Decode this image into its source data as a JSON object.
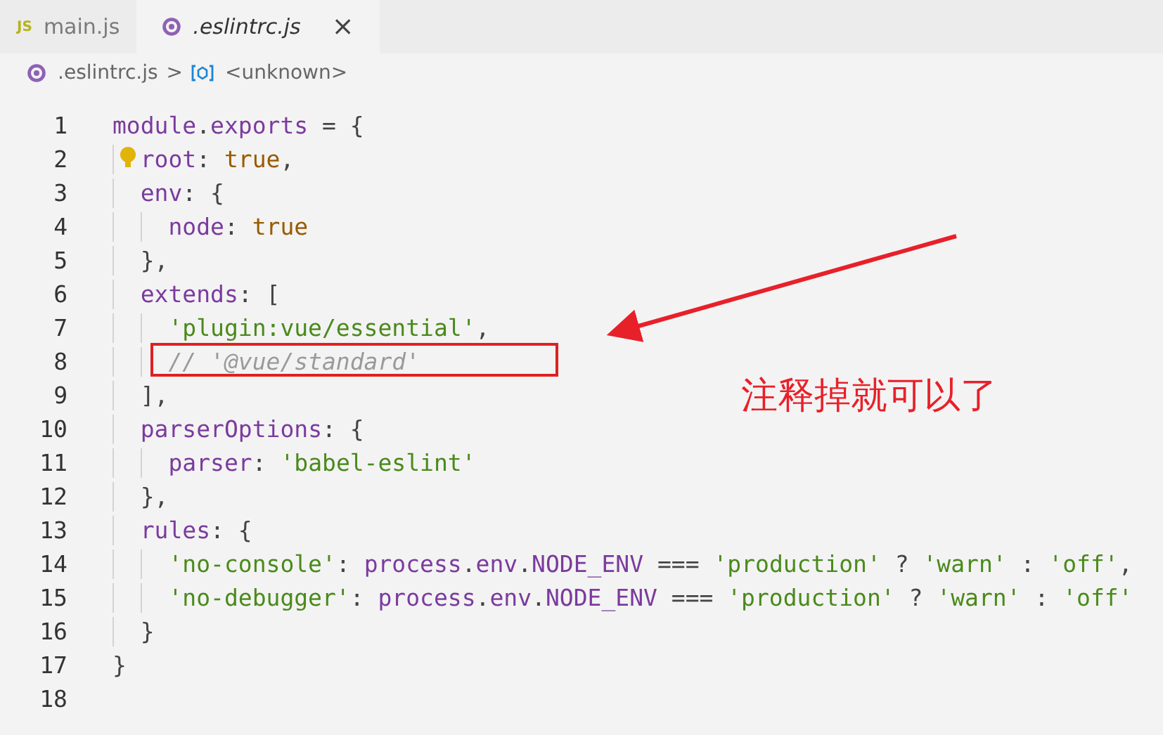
{
  "tabs": [
    {
      "kind": "js",
      "icon_text": "JS",
      "label": "main.js",
      "selected": false
    },
    {
      "kind": "config",
      "label": ".eslintrc.js",
      "selected": true
    }
  ],
  "close_glyph": "×",
  "breadcrumb": {
    "file": ".eslintrc.js",
    "separator": ">",
    "symbol": "<unknown>"
  },
  "lines": [
    {
      "number": "1",
      "boxed": false,
      "tokens": [
        {
          "kind": "ident",
          "text": "module"
        },
        {
          "kind": "punct",
          "text": "."
        },
        {
          "kind": "ident",
          "text": "exports"
        },
        {
          "kind": "punct",
          "text": " = {"
        }
      ]
    },
    {
      "number": "2",
      "boxed": false,
      "bulb": true,
      "tokens": [
        {
          "kind": "ident",
          "text": "root"
        },
        {
          "kind": "punct",
          "text": ": "
        },
        {
          "kind": "kw",
          "text": "true"
        },
        {
          "kind": "punct",
          "text": ","
        }
      ]
    },
    {
      "number": "3",
      "boxed": false,
      "tokens": [
        {
          "kind": "ident",
          "text": "env"
        },
        {
          "kind": "punct",
          "text": ": {"
        }
      ]
    },
    {
      "number": "4",
      "boxed": false,
      "tokens": [
        {
          "kind": "ident",
          "text": "node"
        },
        {
          "kind": "punct",
          "text": ": "
        },
        {
          "kind": "kw",
          "text": "true"
        }
      ]
    },
    {
      "number": "5",
      "boxed": false,
      "tokens": [
        {
          "kind": "punct",
          "text": "},"
        }
      ]
    },
    {
      "number": "6",
      "boxed": false,
      "tokens": [
        {
          "kind": "ident",
          "text": "extends"
        },
        {
          "kind": "punct",
          "text": ": ["
        }
      ]
    },
    {
      "number": "7",
      "boxed": false,
      "tokens": [
        {
          "kind": "str",
          "text": "'plugin:vue/essential'"
        },
        {
          "kind": "punct",
          "text": ","
        }
      ]
    },
    {
      "number": "8",
      "boxed": true,
      "tokens": [
        {
          "kind": "comment",
          "text": "// '@vue/standard'"
        }
      ]
    },
    {
      "number": "9",
      "boxed": false,
      "tokens": [
        {
          "kind": "punct",
          "text": "],"
        }
      ]
    },
    {
      "number": "10",
      "boxed": false,
      "tokens": [
        {
          "kind": "ident",
          "text": "parserOptions"
        },
        {
          "kind": "punct",
          "text": ": {"
        }
      ]
    },
    {
      "number": "11",
      "boxed": false,
      "tokens": [
        {
          "kind": "ident",
          "text": "parser"
        },
        {
          "kind": "punct",
          "text": ": "
        },
        {
          "kind": "str",
          "text": "'babel-eslint'"
        }
      ]
    },
    {
      "number": "12",
      "boxed": false,
      "tokens": [
        {
          "kind": "punct",
          "text": "},"
        }
      ]
    },
    {
      "number": "13",
      "boxed": false,
      "tokens": [
        {
          "kind": "ident",
          "text": "rules"
        },
        {
          "kind": "punct",
          "text": ": {"
        }
      ]
    },
    {
      "number": "14",
      "boxed": false,
      "tokens": [
        {
          "kind": "str",
          "text": "'no-console'"
        },
        {
          "kind": "punct",
          "text": ": "
        },
        {
          "kind": "ident",
          "text": "process"
        },
        {
          "kind": "punct",
          "text": "."
        },
        {
          "kind": "ident",
          "text": "env"
        },
        {
          "kind": "punct",
          "text": "."
        },
        {
          "kind": "ident",
          "text": "NODE_ENV"
        },
        {
          "kind": "punct",
          "text": " === "
        },
        {
          "kind": "str",
          "text": "'production'"
        },
        {
          "kind": "punct",
          "text": " ? "
        },
        {
          "kind": "str",
          "text": "'warn'"
        },
        {
          "kind": "punct",
          "text": " : "
        },
        {
          "kind": "str",
          "text": "'off'"
        },
        {
          "kind": "punct",
          "text": ","
        }
      ]
    },
    {
      "number": "15",
      "boxed": false,
      "tokens": [
        {
          "kind": "str",
          "text": "'no-debugger'"
        },
        {
          "kind": "punct",
          "text": ": "
        },
        {
          "kind": "ident",
          "text": "process"
        },
        {
          "kind": "punct",
          "text": "."
        },
        {
          "kind": "ident",
          "text": "env"
        },
        {
          "kind": "punct",
          "text": "."
        },
        {
          "kind": "ident",
          "text": "NODE_ENV"
        },
        {
          "kind": "punct",
          "text": " === "
        },
        {
          "kind": "str",
          "text": "'production'"
        },
        {
          "kind": "punct",
          "text": " ? "
        },
        {
          "kind": "str",
          "text": "'warn'"
        },
        {
          "kind": "punct",
          "text": " : "
        },
        {
          "kind": "str",
          "text": "'off'"
        }
      ]
    },
    {
      "number": "16",
      "boxed": false,
      "tokens": [
        {
          "kind": "punct",
          "text": "}"
        }
      ]
    },
    {
      "number": "17",
      "boxed": false,
      "tokens": [
        {
          "kind": "punct",
          "text": "}"
        }
      ]
    },
    {
      "number": "18",
      "boxed": false
    }
  ],
  "annotation": {
    "text": "注释掉就可以了"
  }
}
